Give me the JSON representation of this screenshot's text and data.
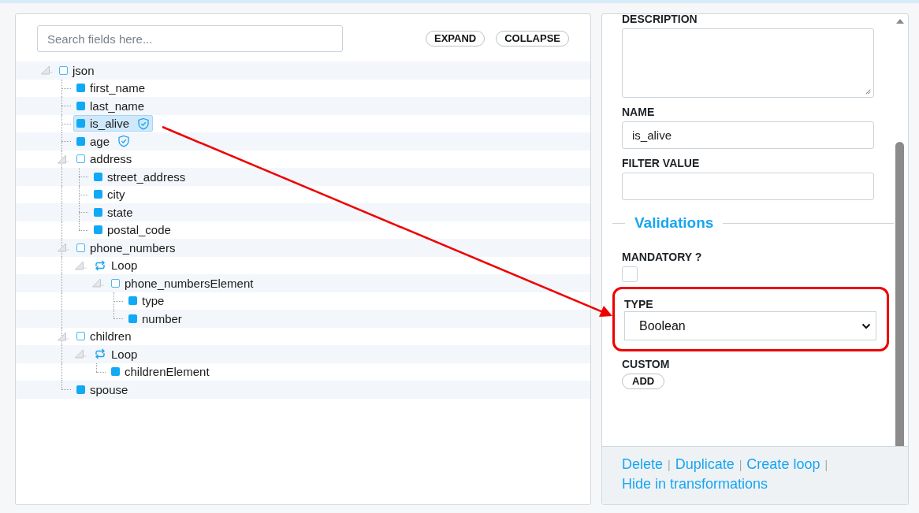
{
  "search": {
    "placeholder": "Search fields here..."
  },
  "buttons": [
    {
      "label": "EXPAND"
    },
    {
      "label": "COLLAPSE"
    }
  ],
  "tree": [
    {
      "label": "json",
      "kind": "object",
      "expanded": true,
      "selected": false,
      "validated": false,
      "children": [
        {
          "label": "first_name",
          "kind": "field",
          "selected": false,
          "validated": false
        },
        {
          "label": "last_name",
          "kind": "field",
          "selected": false,
          "validated": false
        },
        {
          "label": "is_alive",
          "kind": "field",
          "selected": true,
          "validated": true
        },
        {
          "label": "age",
          "kind": "field",
          "selected": false,
          "validated": true
        },
        {
          "label": "address",
          "kind": "object",
          "expanded": true,
          "selected": false,
          "validated": false,
          "children": [
            {
              "label": "street_address",
              "kind": "field",
              "selected": false,
              "validated": false
            },
            {
              "label": "city",
              "kind": "field",
              "selected": false,
              "validated": false
            },
            {
              "label": "state",
              "kind": "field",
              "selected": false,
              "validated": false
            },
            {
              "label": "postal_code",
              "kind": "field",
              "selected": false,
              "validated": false
            }
          ]
        },
        {
          "label": "phone_numbers",
          "kind": "object",
          "expanded": true,
          "selected": false,
          "validated": false,
          "children": [
            {
              "label": "Loop",
              "kind": "loop",
              "expanded": true,
              "selected": false,
              "validated": false,
              "children": [
                {
                  "label": "phone_numbersElement",
                  "kind": "object",
                  "expanded": true,
                  "selected": false,
                  "validated": false,
                  "children": [
                    {
                      "label": "type",
                      "kind": "field",
                      "selected": false,
                      "validated": false
                    },
                    {
                      "label": "number",
                      "kind": "field",
                      "selected": false,
                      "validated": false
                    }
                  ]
                }
              ]
            }
          ]
        },
        {
          "label": "children",
          "kind": "object",
          "expanded": true,
          "selected": false,
          "validated": false,
          "children": [
            {
              "label": "Loop",
              "kind": "loop",
              "expanded": true,
              "selected": false,
              "validated": false,
              "children": [
                {
                  "label": "childrenElement",
                  "kind": "field",
                  "selected": false,
                  "validated": false
                }
              ]
            }
          ]
        },
        {
          "label": "spouse",
          "kind": "field",
          "selected": false,
          "validated": false
        }
      ]
    }
  ],
  "details": {
    "fields": [
      {
        "kind": "textarea",
        "label": "DESCRIPTION"
      },
      {
        "kind": "text",
        "label": "NAME",
        "value": "is_alive"
      },
      {
        "kind": "text",
        "label": "FILTER VALUE"
      }
    ],
    "validations": {
      "title": "Validations",
      "mandatory": {
        "label": "MANDATORY ?",
        "checked": false
      },
      "type": {
        "label": "TYPE",
        "value": "Boolean",
        "highlighted": true
      },
      "custom": {
        "label": "CUSTOM",
        "button": "ADD"
      }
    }
  },
  "footer": {
    "separator": "|",
    "links": [
      "Delete",
      "Duplicate",
      "Create loop",
      "Hide in transformations"
    ]
  }
}
